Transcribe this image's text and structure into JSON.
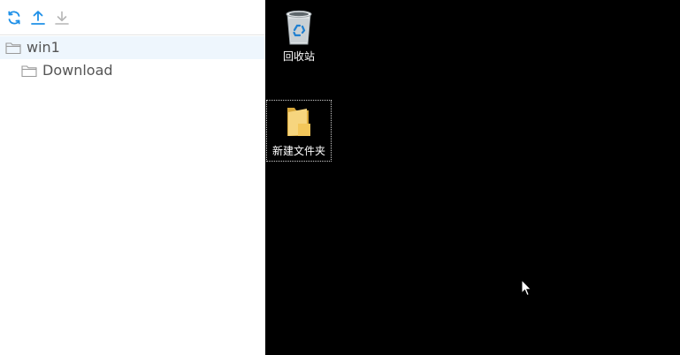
{
  "colors": {
    "toolbar_active": "#1e90e8",
    "toolbar_disabled": "#b5b5b5",
    "folder_outline": "#9a9a9a",
    "selected_row_bg": "#eef6fd",
    "desktop_bg": "#000000",
    "desktop_folder": "#f3c75a"
  },
  "toolbar": {
    "refresh_icon": "refresh-icon",
    "upload_icon": "upload-icon",
    "download_icon": "download-icon"
  },
  "tree": {
    "items": [
      {
        "label": "win1",
        "icon": "folder-icon",
        "selected": true
      },
      {
        "label": "Download",
        "icon": "folder-icon",
        "selected": false
      }
    ]
  },
  "desktop": {
    "icons": [
      {
        "label": "回收站",
        "icon": "recycle-bin-icon",
        "selected": false
      },
      {
        "label": "新建文件夹",
        "icon": "folder-icon",
        "selected": true
      }
    ]
  }
}
